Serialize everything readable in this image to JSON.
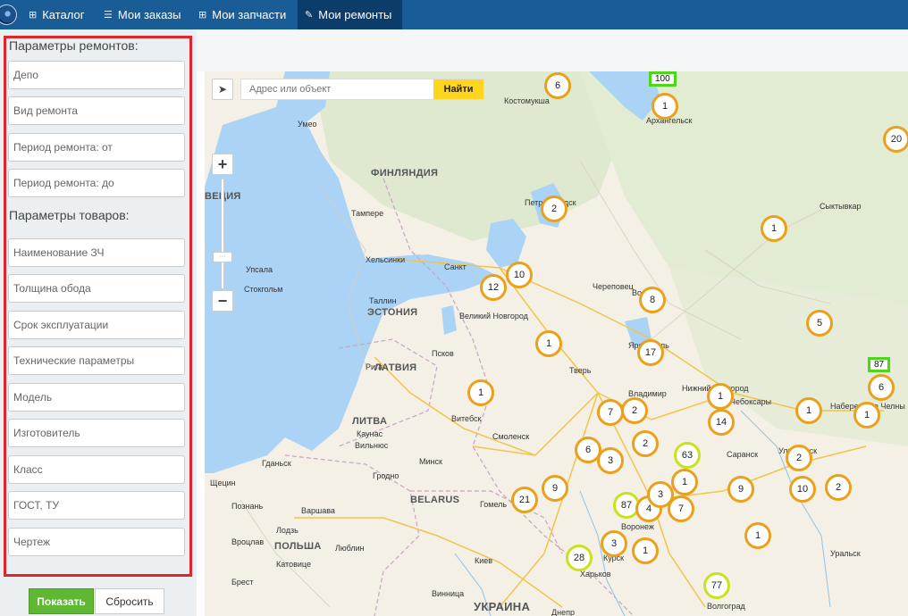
{
  "nav": {
    "items": [
      {
        "label": "Каталог",
        "icon": "sitemap-icon"
      },
      {
        "label": "Мои заказы",
        "icon": "list-icon"
      },
      {
        "label": "Мои запчасти",
        "icon": "sitemap-icon"
      },
      {
        "label": "Мои ремонты",
        "icon": "wrench-icon"
      }
    ]
  },
  "sidebar": {
    "repair_params_title": "Параметры ремонтов:",
    "repair_fields": [
      "Депо",
      "Вид ремонта",
      "Период ремонта: от",
      "Период ремонта: до"
    ],
    "goods_params_title": "Параметры товаров:",
    "goods_fields": [
      "Наименование ЗЧ",
      "Толщина обода",
      "Срок эксплуатации",
      "Технические параметры",
      "Модель",
      "Изготовитель",
      "Класс",
      "ГОСТ, ТУ",
      "Чертеж"
    ],
    "show_button": "Показать",
    "reset_button": "Сбросить"
  },
  "map": {
    "search_placeholder": "Адрес или объект",
    "search_button": "Найти",
    "zoom_in": "+",
    "zoom_out": "−",
    "countries": [
      "ФИНЛЯНДИЯ",
      "ЭСТОНИЯ",
      "ЛИТВА",
      "BELARUS",
      "ПОЛЬША",
      "УКРАИНА",
      "ВЕЦИЯ",
      "ЛАТВИЯ"
    ],
    "cities": [
      "Костомукша",
      "Умео",
      "Тампере",
      "Хельсинки",
      "Упсала",
      "Стокгольм",
      "Таллин",
      "Санкт",
      "Петрозаводск",
      "Сыктывкар",
      "Великий Новгород",
      "Череповец",
      "Вологда",
      "Ярославль",
      "Псков",
      "Рига",
      "Тверь",
      "Владимир",
      "Нижний Новгород",
      "Чебоксары",
      "Набережные Челны",
      "Вильнюс",
      "Каунас",
      "Витебск",
      "Смоленск",
      "Гданьск",
      "Минск",
      "Гродно",
      "Щецин",
      "Познань",
      "Варшава",
      "Гомель",
      "Воронеж",
      "Саранск",
      "Ульяновск",
      "Вроцлав",
      "Лодзь",
      "Люблин",
      "Катовице",
      "Киев",
      "Харьков",
      "Винница",
      "Уральск",
      "Волгоград",
      "Днепр",
      "Архангельск",
      "Брест",
      "Курск"
    ],
    "clusters": [
      "6",
      "1",
      "20",
      "2",
      "1",
      "10",
      "12",
      "8",
      "5",
      "1",
      "17",
      "1",
      "1",
      "7",
      "2",
      "14",
      "1",
      "1",
      "6",
      "3",
      "2",
      "63",
      "1",
      "9",
      "2",
      "10",
      "2",
      "21",
      "9",
      "87",
      "4",
      "3",
      "7",
      "3",
      "1",
      "1",
      "28",
      "77",
      "6"
    ],
    "flags": [
      "100",
      "87"
    ]
  }
}
